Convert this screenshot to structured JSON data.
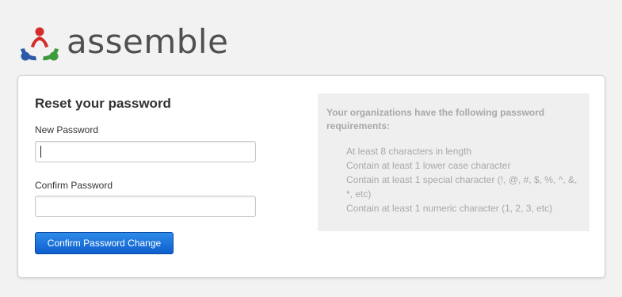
{
  "brand": {
    "name": "assemble",
    "logo_colors": [
      "#d42b2b",
      "#2a5aa8",
      "#3c9b3c"
    ]
  },
  "form": {
    "title": "Reset your password",
    "new_password_label": "New Password",
    "new_password_value": "",
    "confirm_password_label": "Confirm Password",
    "confirm_password_value": "",
    "submit_label": "Confirm Password Change"
  },
  "requirements": {
    "heading": "Your organizations have the following password requirements:",
    "items": [
      "At least 8 characters in length",
      "Contain at least 1 lower case character",
      "Contain at least 1 special character (!, @, #, $, %, ^, &, *, etc)",
      "Contain at least 1 numeric character (1, 2, 3, etc)"
    ]
  },
  "colors": {
    "button": "#1a6fd8",
    "background": "#f2f2f2",
    "requirements_box": "#efefef"
  }
}
